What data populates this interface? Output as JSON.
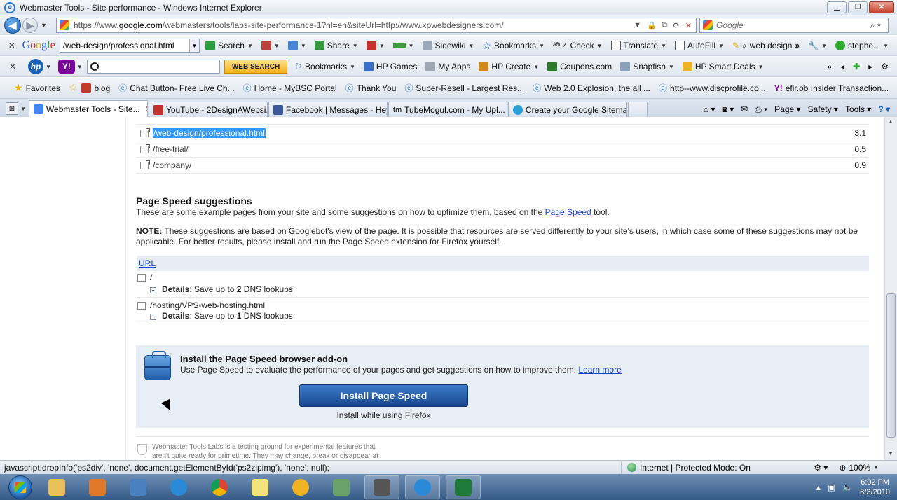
{
  "window": {
    "title": "Webmaster Tools - Site performance - Windows Internet Explorer"
  },
  "address": {
    "url_prefix": "https://www.",
    "url_domain": "google.com",
    "url_rest": "/webmasters/tools/labs-site-performance-1?hl=en&siteUrl=http://www.xpwebdesigners.com/",
    "search_placeholder": "Google"
  },
  "google_toolbar": {
    "query": "/web-design/professional.html",
    "items": [
      "Search",
      "Share",
      "Sidewiki",
      "Bookmarks",
      "Check",
      "Translate",
      "AutoFill",
      "web design",
      "stephe..."
    ]
  },
  "hp_toolbar": {
    "web_search_label": "WEB SEARCH",
    "items": [
      "Bookmarks",
      "HP Games",
      "My Apps",
      "HP Create",
      "Coupons.com",
      "Snapfish",
      "HP Smart Deals"
    ]
  },
  "favorites_bar": {
    "label": "Favorites",
    "items": [
      "blog",
      "Chat Button- Free Live Ch...",
      "Home - MyBSC Portal",
      "Thank You",
      "Super-Resell - Largest Res...",
      "Web 2.0 Explosion, the all ...",
      "http--www.discprofile.co...",
      "efir.ob Insider Transaction..."
    ]
  },
  "tabs": {
    "items": [
      "Webmaster Tools - Site...",
      "YouTube - 2DesignAWebsi...",
      "Facebook | Messages - Hey!!",
      "TubeMogul.com - My Upl...",
      "Create your Google Sitema..."
    ],
    "commands": [
      "Page",
      "Safety",
      "Tools"
    ]
  },
  "content": {
    "top_rows": [
      {
        "url": "/web-design/professional.html",
        "value": "3.1"
      },
      {
        "url": "/free-trial/",
        "value": "0.5"
      },
      {
        "url": "/company/",
        "value": "0.9"
      }
    ],
    "suggestions_title": "Page Speed suggestions",
    "suggestions_intro": "These are some example pages from your site and some suggestions on how to optimize them, based on the",
    "page_speed_link": "Page Speed",
    "suggestions_tail": "tool.",
    "note_label": "NOTE:",
    "note_line1": "These suggestions are based on Googlebot's view of the page. It is possible that resources are served differently to your site's users, in which case some of these suggestions may not be",
    "note_line2": "applicable. For better results, please install and run the Page Speed extension for Firefox yourself.",
    "url_header": "URL",
    "pages": [
      {
        "url": "/",
        "details_label": "Details",
        "details_pre": ": Save up to ",
        "count": "2",
        "details_post": " DNS lookups"
      },
      {
        "url": "/hosting/VPS-web-hosting.html",
        "details_label": "Details",
        "details_pre": ": Save up to ",
        "count": "1",
        "details_post": " DNS lookups"
      }
    ],
    "install": {
      "title": "Install the Page Speed browser add-on",
      "desc": "Use Page Speed to evaluate the performance of your pages and get suggestions on how to improve them.",
      "learn_more": "Learn more",
      "button": "Install Page Speed",
      "sub": "Install while using Firefox"
    },
    "labs_text": "Webmaster Tools Labs is a testing ground for experimental features that aren't quite ready for primetime. They may change, break or disappear at"
  },
  "status": {
    "text": "javascript:dropInfo('ps2div', 'none',    document.getElementById('ps2zipimg'), 'none', null);",
    "zone": "Internet | Protected Mode: On",
    "zoom": "100%"
  },
  "taskbar": {
    "time": "6:02 PM",
    "date": "8/3/2010"
  }
}
